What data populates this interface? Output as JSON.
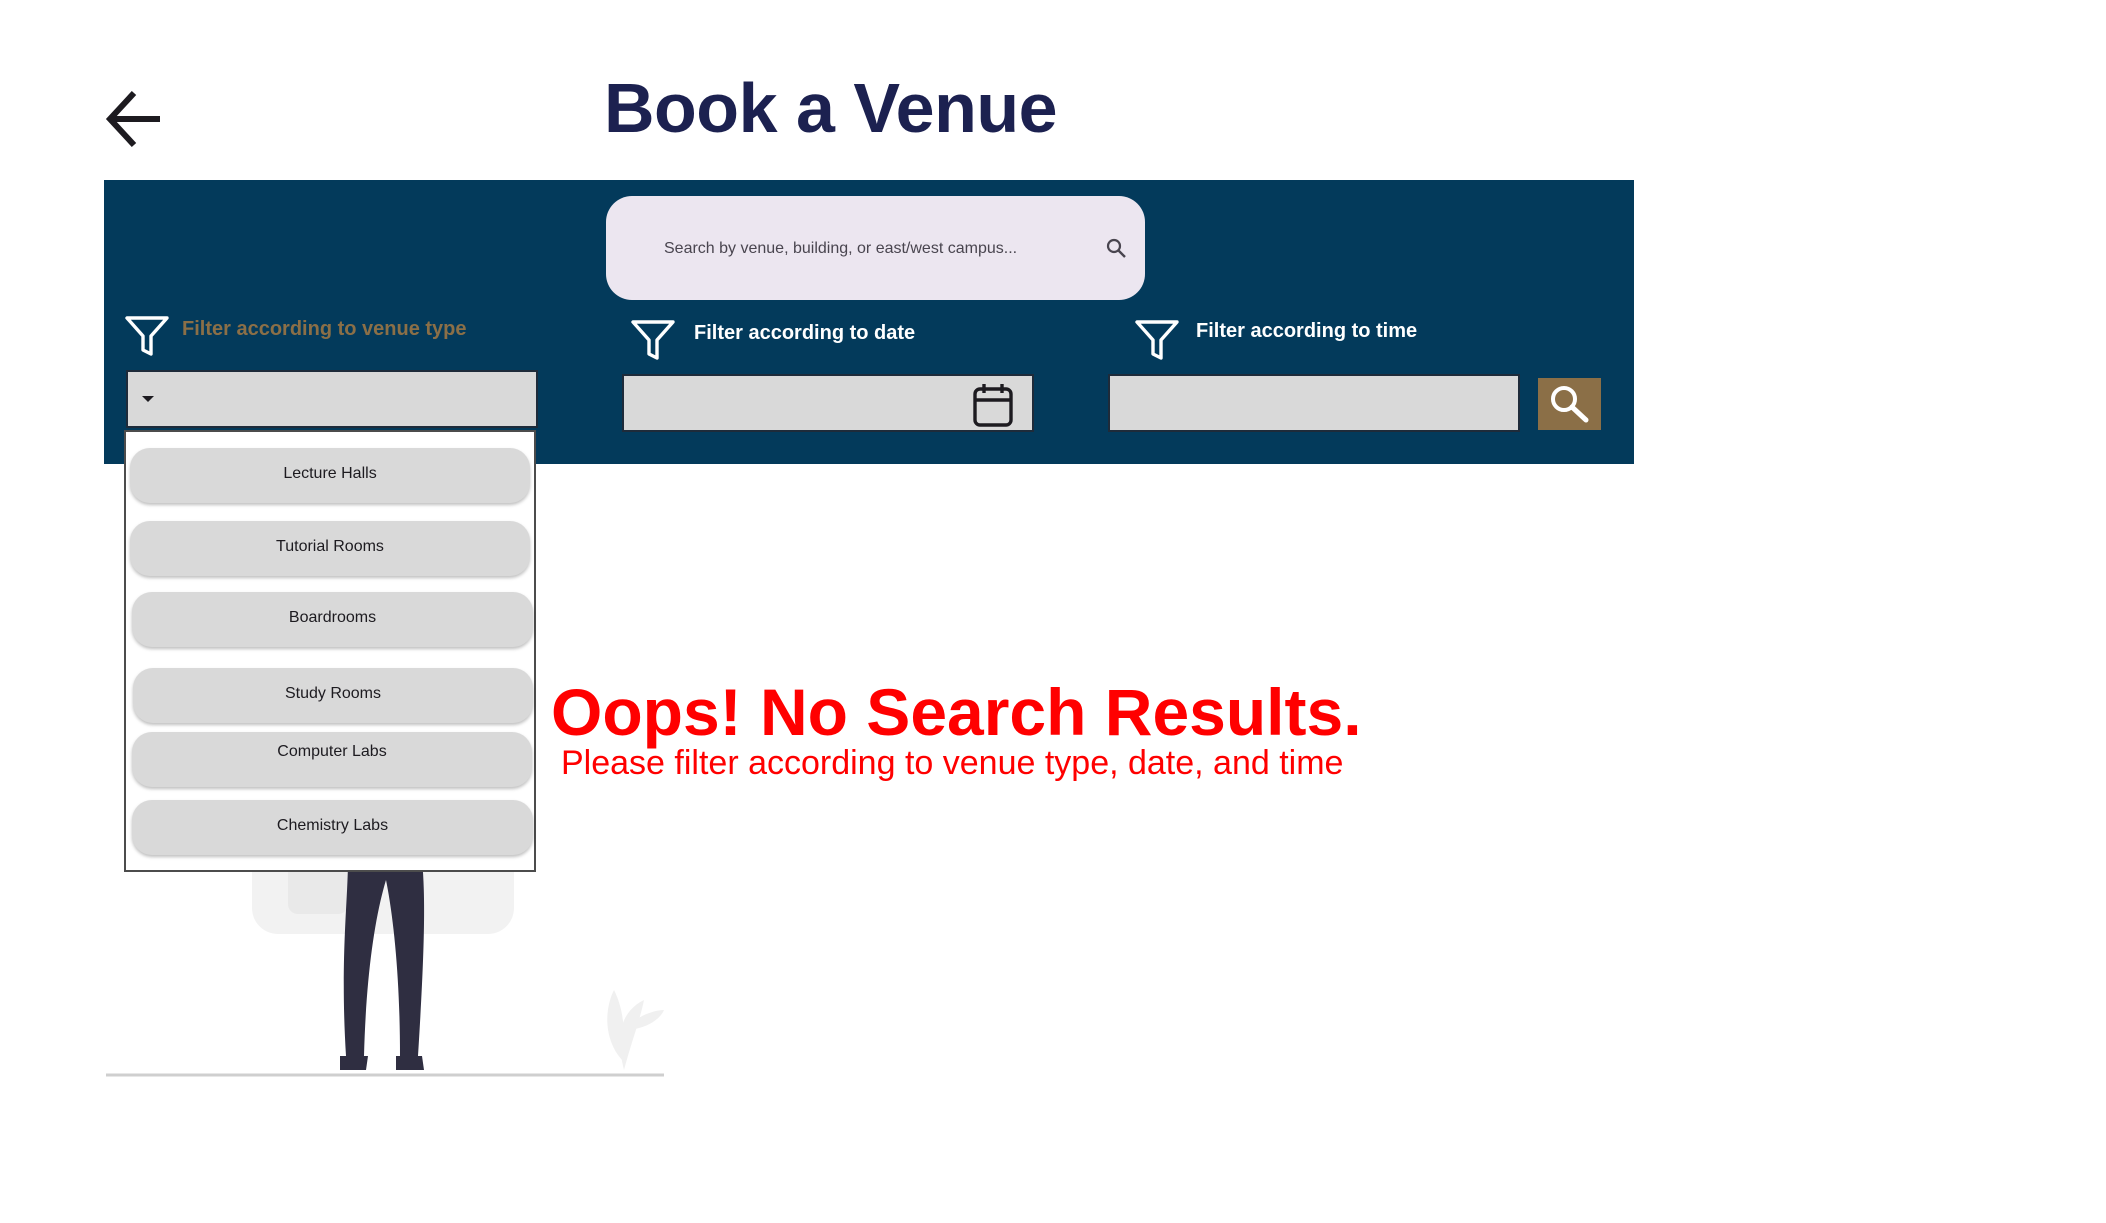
{
  "header": {
    "title": "Book a Venue",
    "back_icon": "arrow-left-icon"
  },
  "search": {
    "placeholder": "Search by venue, building, or east/west campus...",
    "value": "",
    "icon": "search-icon"
  },
  "filters": {
    "venue_type": {
      "label": "Filter according to venue type",
      "label_color": "#8b6f47",
      "icon": "funnel-icon",
      "selected": "",
      "options": [
        "Lecture Halls",
        "Tutorial Rooms",
        "Boardrooms",
        "Study Rooms",
        "Computer Labs",
        "Chemistry Labs"
      ]
    },
    "date": {
      "label": "Filter according to date",
      "label_color": "#ffffff",
      "icon": "funnel-icon",
      "value": "",
      "picker_icon": "calendar-icon"
    },
    "time": {
      "label": "Filter according to time",
      "label_color": "#ffffff",
      "icon": "funnel-icon",
      "value": ""
    },
    "submit_icon": "magnifier-icon"
  },
  "message": {
    "title": "Oops! No Search Results.",
    "subtitle": "Please filter according to venue type,  date, and time",
    "color": "#ff0000"
  },
  "colors": {
    "banner": "#033a5b",
    "title": "#1c2150",
    "accent": "#8b6f47",
    "field": "#d9d9d9",
    "search_bg": "#ece6f0"
  }
}
